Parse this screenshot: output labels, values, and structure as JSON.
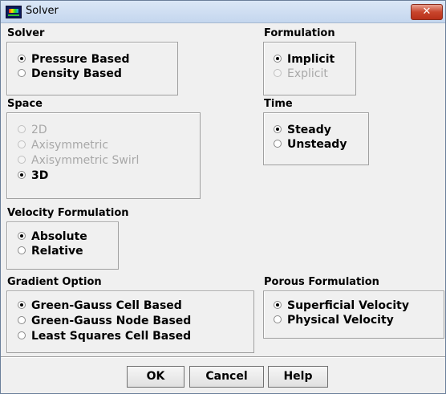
{
  "window": {
    "title": "Solver",
    "close_label": "✕"
  },
  "solver": {
    "label": "Solver",
    "options": [
      "Pressure Based",
      "Density Based"
    ]
  },
  "formulation": {
    "label": "Formulation",
    "options": [
      "Implicit",
      "Explicit"
    ]
  },
  "space": {
    "label": "Space",
    "options": [
      "2D",
      "Axisymmetric",
      "Axisymmetric Swirl",
      "3D"
    ]
  },
  "time": {
    "label": "Time",
    "options": [
      "Steady",
      "Unsteady"
    ]
  },
  "velocity_formulation": {
    "label": "Velocity Formulation",
    "options": [
      "Absolute",
      "Relative"
    ]
  },
  "gradient_option": {
    "label": "Gradient Option",
    "options": [
      "Green-Gauss Cell Based",
      "Green-Gauss Node Based",
      "Least Squares Cell Based"
    ]
  },
  "porous_formulation": {
    "label": "Porous Formulation",
    "options": [
      "Superficial Velocity",
      "Physical Velocity"
    ]
  },
  "buttons": {
    "ok": "OK",
    "cancel": "Cancel",
    "help": "Help"
  }
}
